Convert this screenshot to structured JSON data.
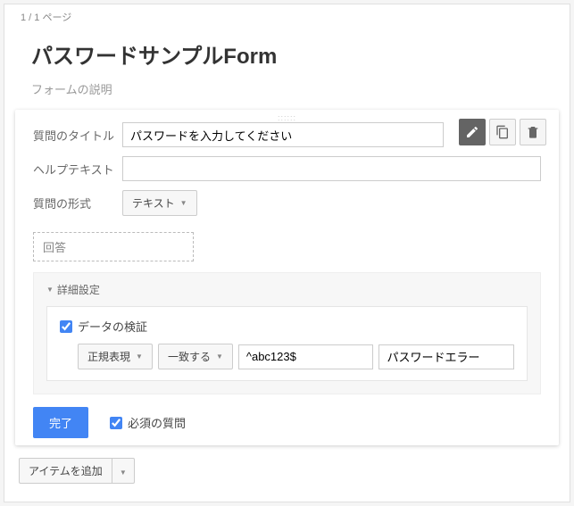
{
  "page_indicator": "1 / 1 ページ",
  "form": {
    "title": "パスワードサンプルForm",
    "description": "フォームの説明"
  },
  "question": {
    "title_label": "質問のタイトル",
    "title_value": "パスワードを入力してください",
    "help_label": "ヘルプテキスト",
    "help_value": "",
    "type_label": "質問の形式",
    "type_value": "テキスト",
    "answer_placeholder": "回答"
  },
  "advanced": {
    "header": "詳細設定",
    "validation_check_label": "データの検証",
    "validation_checked": true,
    "rule_type": "正規表現",
    "match_type": "一致する",
    "pattern": "^abc123$",
    "error_msg": "パスワードエラー"
  },
  "footer": {
    "done": "完了",
    "required_label": "必須の質問",
    "required_checked": true
  },
  "add_item": "アイテムを追加"
}
